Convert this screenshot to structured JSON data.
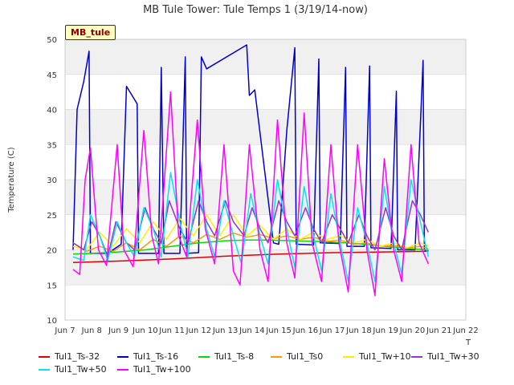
{
  "chart_data": {
    "type": "line",
    "title": "MB Tule Tower: Tule Temps 1 (3/19/14-now)",
    "ylabel": "Temperature (C)",
    "xlabel": "",
    "badge": "MB_tule",
    "corner_label": "T",
    "ylim": [
      10,
      50
    ],
    "xlim": [
      7,
      22
    ],
    "yticks": [
      10,
      15,
      20,
      25,
      30,
      35,
      40,
      45,
      50
    ],
    "xticks": [
      {
        "v": 7,
        "label": "Jun 7"
      },
      {
        "v": 8,
        "label": "Jun 8"
      },
      {
        "v": 9,
        "label": "Jun 9"
      },
      {
        "v": 10,
        "label": "Jun 10"
      },
      {
        "v": 11,
        "label": "Jun 11"
      },
      {
        "v": 12,
        "label": "Jun 12"
      },
      {
        "v": 13,
        "label": "Jun 13"
      },
      {
        "v": 14,
        "label": "Jun 14"
      },
      {
        "v": 15,
        "label": "Jun 15"
      },
      {
        "v": 16,
        "label": "Jun 16"
      },
      {
        "v": 17,
        "label": "Jun 17"
      },
      {
        "v": 18,
        "label": "Jun 18"
      },
      {
        "v": 19,
        "label": "Jun 19"
      },
      {
        "v": 20,
        "label": "Jun 20"
      },
      {
        "v": 21,
        "label": "Jun 21"
      },
      {
        "v": 22,
        "label": "Jun 22"
      }
    ],
    "grid": true,
    "series": [
      {
        "name": "Tul1_Ts-32",
        "color": "#e00000",
        "x": [
          7.3,
          9,
          11,
          13,
          15,
          17,
          19,
          20.6
        ],
        "y": [
          18.2,
          18.4,
          18.7,
          19.1,
          19.4,
          19.6,
          19.7,
          19.8
        ]
      },
      {
        "name": "Tul1_Ts-16",
        "color": "#0000cc",
        "x": [
          7.3,
          7.45,
          7.7,
          7.9,
          7.95,
          8.6,
          9.1,
          9.3,
          9.7,
          9.75,
          10.5,
          10.6,
          10.7,
          11.3,
          11.5,
          11.55,
          12.0,
          12.1,
          12.3,
          13.8,
          13.9,
          14.1,
          14.8,
          15.0,
          15.3,
          15.6,
          15.65,
          16.3,
          16.5,
          16.55,
          17.3,
          17.5,
          17.55,
          18.2,
          18.4,
          18.45,
          19.2,
          19.4,
          19.45,
          20.1,
          20.4,
          20.45,
          20.6
        ],
        "y": [
          20,
          40,
          44,
          48.3,
          19.5,
          19.5,
          20.8,
          43.3,
          40.8,
          19.5,
          19.5,
          46,
          19.5,
          19.5,
          47.5,
          19.5,
          19.6,
          47.5,
          45.8,
          49.2,
          42,
          42.8,
          21,
          20.8,
          37,
          48.8,
          20.8,
          20.7,
          47.2,
          21,
          20.9,
          46,
          20.5,
          20.5,
          46.2,
          20.3,
          20.2,
          42.6,
          20,
          20,
          47,
          20,
          19.9
        ]
      },
      {
        "name": "Tul1_Ts-8",
        "color": "#00dd00",
        "x": [
          7.3,
          8,
          9,
          10,
          11,
          12,
          13,
          13.8,
          14.5,
          15.5,
          16.5,
          17.5,
          18.5,
          19.5,
          20.6
        ],
        "y": [
          19.4,
          19.5,
          19.7,
          20,
          20.5,
          21,
          21.3,
          21.4,
          21.4,
          21.3,
          21.2,
          21,
          20.7,
          20.3,
          20
        ]
      },
      {
        "name": "Tul1_Ts0",
        "color": "#ff9900",
        "x": [
          7.3,
          7.8,
          8.3,
          8.8,
          9.3,
          9.8,
          10.3,
          10.8,
          11.3,
          11.8,
          12.3,
          12.8,
          13.3,
          13.8,
          14.3,
          14.8,
          15.3,
          15.8,
          16.3,
          16.8,
          17.3,
          17.8,
          18.3,
          18.8,
          19.3,
          19.8,
          20.3,
          20.6
        ],
        "y": [
          21,
          19.8,
          20.5,
          19.8,
          21,
          20,
          21.5,
          20.5,
          22,
          21,
          22.2,
          21.5,
          22.4,
          21.8,
          22.2,
          21.6,
          22,
          21.5,
          21.8,
          21.2,
          21.4,
          20.8,
          21,
          20.5,
          20.6,
          20.3,
          20.5,
          20.2
        ]
      },
      {
        "name": "Tul1_Tw+10",
        "color": "#ffee00",
        "x": [
          7.3,
          7.8,
          8.3,
          8.8,
          9.3,
          9.8,
          10.3,
          10.8,
          11.3,
          11.8,
          12.3,
          12.8,
          13.3,
          13.8,
          14.3,
          14.8,
          15.3,
          15.8,
          16.3,
          16.8,
          17.3,
          17.8,
          18.3,
          18.8,
          19.3,
          19.8,
          20.3,
          20.6
        ],
        "y": [
          20.5,
          20,
          22.5,
          20.5,
          23,
          21,
          24,
          21.5,
          24.5,
          22,
          25,
          22,
          25,
          22,
          23.5,
          21.5,
          23,
          21.5,
          22.5,
          21.5,
          22,
          21,
          21.5,
          20.5,
          21,
          20.3,
          21,
          20.5
        ]
      },
      {
        "name": "Tul1_Tw+30",
        "color": "#9933cc",
        "x": [
          7.3,
          7.7,
          8.0,
          8.3,
          8.6,
          8.9,
          9.3,
          9.6,
          10.0,
          10.3,
          10.6,
          10.9,
          11.3,
          11.6,
          12.0,
          12.3,
          12.6,
          13.0,
          13.3,
          13.7,
          14.0,
          14.3,
          14.6,
          15.0,
          15.3,
          15.6,
          16.0,
          16.3,
          16.6,
          17.0,
          17.3,
          17.6,
          18.0,
          18.3,
          18.6,
          19.0,
          19.3,
          19.6,
          20.0,
          20.3,
          20.6
        ],
        "y": [
          21,
          20,
          24,
          22,
          19,
          24,
          21,
          20,
          26,
          23,
          21,
          27,
          23,
          21,
          27,
          24,
          22,
          27,
          24,
          22,
          26,
          23,
          21,
          27,
          24,
          22,
          26,
          23,
          21,
          25,
          23,
          21,
          25,
          22,
          20,
          26,
          22,
          20,
          27,
          25,
          22.5
        ]
      },
      {
        "name": "Tul1_Tw+50",
        "color": "#00e5ee",
        "x": [
          7.3,
          7.7,
          7.95,
          8.3,
          8.6,
          8.95,
          9.3,
          9.6,
          9.95,
          10.3,
          10.6,
          10.95,
          11.3,
          11.6,
          11.95,
          12.3,
          12.6,
          12.95,
          13.3,
          13.6,
          13.95,
          14.3,
          14.6,
          14.95,
          15.3,
          15.6,
          15.95,
          16.3,
          16.6,
          16.95,
          17.3,
          17.6,
          17.95,
          18.3,
          18.6,
          18.95,
          19.3,
          19.6,
          19.95,
          20.3,
          20.6
        ],
        "y": [
          19,
          18.5,
          25,
          22,
          18.5,
          24,
          21,
          19,
          26,
          23,
          19,
          31,
          24,
          19,
          30,
          23,
          19,
          27,
          22,
          18,
          28,
          22,
          18,
          30,
          23,
          17.5,
          29,
          22,
          17,
          28,
          21,
          15.5,
          26,
          21,
          15.5,
          29,
          21,
          16.5,
          30,
          24,
          19
        ]
      },
      {
        "name": "Tul1_Tw+100",
        "color": "#ff00ff",
        "x": [
          7.3,
          7.55,
          7.75,
          7.95,
          8.25,
          8.55,
          8.95,
          9.2,
          9.55,
          9.95,
          10.25,
          10.5,
          10.95,
          11.25,
          11.55,
          11.95,
          12.25,
          12.6,
          12.95,
          13.3,
          13.55,
          13.9,
          14.3,
          14.6,
          14.95,
          15.3,
          15.6,
          15.95,
          16.25,
          16.6,
          16.95,
          17.25,
          17.6,
          17.95,
          18.3,
          18.6,
          18.95,
          19.3,
          19.6,
          19.95,
          20.25,
          20.6
        ],
        "y": [
          17.2,
          16.5,
          30,
          34.5,
          20,
          17.8,
          35,
          20,
          17.6,
          37,
          22,
          18,
          42.5,
          22,
          19,
          38.5,
          23,
          18,
          35,
          17,
          15,
          35,
          20,
          15.5,
          38.5,
          21,
          16,
          39.5,
          21,
          15.5,
          35,
          21,
          14,
          35,
          20,
          13.5,
          33,
          20,
          15.5,
          35,
          21,
          18
        ]
      }
    ]
  }
}
